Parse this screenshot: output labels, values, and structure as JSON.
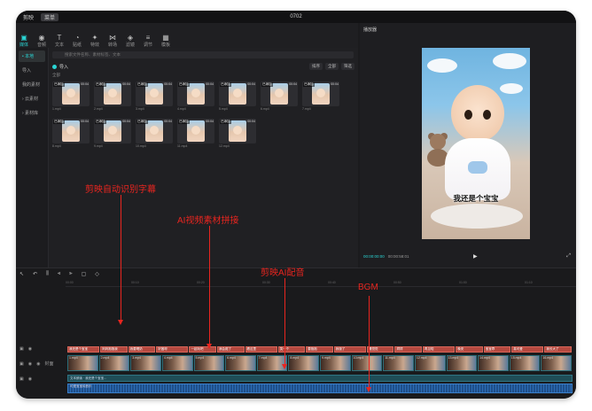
{
  "window": {
    "app_title": "剪映",
    "menu_label": "菜单",
    "doc_title": "0702"
  },
  "toolbar": {
    "tools": [
      {
        "icon": "media-icon",
        "glyph": "▣",
        "label": "媒体",
        "active": true
      },
      {
        "icon": "audio-icon",
        "glyph": "◉",
        "label": "音频",
        "active": false
      },
      {
        "icon": "text-icon",
        "glyph": "T",
        "label": "文本",
        "active": false
      },
      {
        "icon": "sticker-icon",
        "glyph": "◔",
        "label": "贴纸",
        "active": false
      },
      {
        "icon": "effects-icon",
        "glyph": "✦",
        "label": "特效",
        "active": false
      },
      {
        "icon": "transition-icon",
        "glyph": "⋈",
        "label": "转场",
        "active": false
      },
      {
        "icon": "filter-icon",
        "glyph": "◈",
        "label": "滤镜",
        "active": false
      },
      {
        "icon": "adjust-icon",
        "glyph": "≡",
        "label": "调节",
        "active": false
      },
      {
        "icon": "template-icon",
        "glyph": "▦",
        "label": "模板",
        "active": false
      }
    ]
  },
  "leftnav": {
    "items": [
      {
        "label": "• 本地",
        "active": true
      },
      {
        "label": "导入",
        "active": false
      },
      {
        "label": "我的素材",
        "active": false
      },
      {
        "label": "› 云素材",
        "active": false
      },
      {
        "label": "› 素材库",
        "active": false
      }
    ]
  },
  "media": {
    "search_placeholder": "搜索文件名称、素材标签、文本",
    "import_label": "导入",
    "sort_controls": [
      "排序",
      "全部",
      "筛选"
    ],
    "section_label": "全部",
    "clips": [
      {
        "tag": "已添加",
        "dur": "00:04",
        "name": "1.mp4"
      },
      {
        "tag": "已添加",
        "dur": "00:04",
        "name": "2.mp4"
      },
      {
        "tag": "已添加",
        "dur": "00:04",
        "name": "3.mp4"
      },
      {
        "tag": "已添加",
        "dur": "00:04",
        "name": "4.mp4"
      },
      {
        "tag": "已添加",
        "dur": "00:04",
        "name": "5.mp4"
      },
      {
        "tag": "已添加",
        "dur": "00:04",
        "name": "6.mp4"
      },
      {
        "tag": "已添加",
        "dur": "00:04",
        "name": "7.mp4"
      },
      {
        "tag": "已添加",
        "dur": "00:04",
        "name": "8.mp4"
      },
      {
        "tag": "已添加",
        "dur": "00:04",
        "name": "9.mp4"
      },
      {
        "tag": "已添加",
        "dur": "00:04",
        "name": "10.mp4"
      },
      {
        "tag": "已添加",
        "dur": "00:04",
        "name": "11.mp4"
      },
      {
        "tag": "已添加",
        "dur": "00:04",
        "name": "12.mp4"
      }
    ]
  },
  "player": {
    "title": "播放器",
    "subtitle_text": "我还是个宝宝",
    "time_current": "00:00:00:00",
    "time_total": "00:00:58:01"
  },
  "timeline": {
    "ruler_marks": [
      "00:00",
      "00:10",
      "00:20",
      "00:30",
      "00:40",
      "00:50",
      "01:00",
      "01:10"
    ],
    "video_track_label": "封面",
    "subtitle_segments": [
      "我还是个宝宝",
      "妈妈抱抱我",
      "我要喝奶",
      "好困呀",
      "一起玩吧",
      "我会爬了",
      "看这里",
      "笑一个",
      "要抱抱",
      "我饿了",
      "睡觉觉",
      "拜拜",
      "再见啦",
      "晚安",
      "宝宝乖",
      "真可爱",
      "我长大了"
    ],
    "video_segments": [
      "1.mp4",
      "2.mp4",
      "3.mp4",
      "4.mp4",
      "5.mp4",
      "6.mp4",
      "7.mp4",
      "8.mp4",
      "9.mp4",
      "10.mp4",
      "11.mp4",
      "12.mp4",
      "13.mp4",
      "14.mp4",
      "15.mp4",
      "16.mp4"
    ],
    "voice_label": "文本朗读 · 我还是个宝宝...",
    "bgm_label": "可爱宝宝纯音乐"
  },
  "annotations": {
    "subtitles": "剪映自动识别字幕",
    "ai_stitch": "AI视频素材拼接",
    "ai_voice": "剪映AI配音",
    "bgm": "BGM"
  },
  "colors": {
    "accent": "#2ad4d4",
    "annotation_red": "#e8251f",
    "subtitle_track": "#b5493f",
    "bgm_track": "#1e4f8a"
  }
}
